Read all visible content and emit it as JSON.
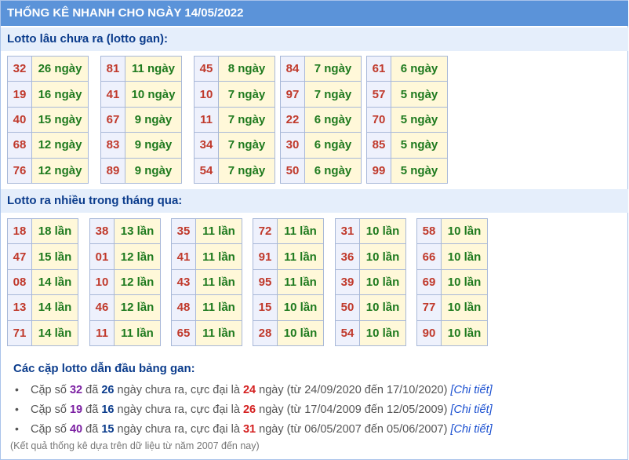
{
  "header": {
    "title": "THỐNG KÊ NHANH CHO NGÀY 14/05/2022"
  },
  "section_gan": {
    "title": "Lotto lâu chưa ra (lotto gan):",
    "groups": [
      [
        {
          "num": "32",
          "val": "26 ngày"
        },
        {
          "num": "19",
          "val": "16 ngày"
        },
        {
          "num": "40",
          "val": "15 ngày"
        },
        {
          "num": "68",
          "val": "12 ngày"
        },
        {
          "num": "76",
          "val": "12 ngày"
        }
      ],
      [
        {
          "num": "81",
          "val": "11 ngày"
        },
        {
          "num": "41",
          "val": "10 ngày"
        },
        {
          "num": "67",
          "val": "9 ngày"
        },
        {
          "num": "83",
          "val": "9 ngày"
        },
        {
          "num": "89",
          "val": "9 ngày"
        }
      ],
      [
        {
          "num": "45",
          "val": "8 ngày"
        },
        {
          "num": "10",
          "val": "7 ngày"
        },
        {
          "num": "11",
          "val": "7 ngày"
        },
        {
          "num": "34",
          "val": "7 ngày"
        },
        {
          "num": "54",
          "val": "7 ngày"
        }
      ],
      [
        {
          "num": "84",
          "val": "7 ngày"
        },
        {
          "num": "97",
          "val": "7 ngày"
        },
        {
          "num": "22",
          "val": "6 ngày"
        },
        {
          "num": "30",
          "val": "6 ngày"
        },
        {
          "num": "50",
          "val": "6 ngày"
        }
      ],
      [
        {
          "num": "61",
          "val": "6 ngày"
        },
        {
          "num": "57",
          "val": "5 ngày"
        },
        {
          "num": "70",
          "val": "5 ngày"
        },
        {
          "num": "85",
          "val": "5 ngày"
        },
        {
          "num": "99",
          "val": "5 ngày"
        }
      ]
    ]
  },
  "section_frequent": {
    "title": "Lotto ra nhiều trong tháng qua:",
    "groups": [
      [
        {
          "num": "18",
          "val": "18 lần"
        },
        {
          "num": "47",
          "val": "15 lần"
        },
        {
          "num": "08",
          "val": "14 lần"
        },
        {
          "num": "13",
          "val": "14 lần"
        },
        {
          "num": "71",
          "val": "14 lần"
        }
      ],
      [
        {
          "num": "38",
          "val": "13 lần"
        },
        {
          "num": "01",
          "val": "12 lần"
        },
        {
          "num": "10",
          "val": "12 lần"
        },
        {
          "num": "46",
          "val": "12 lần"
        },
        {
          "num": "11",
          "val": "11 lần"
        }
      ],
      [
        {
          "num": "35",
          "val": "11 lần"
        },
        {
          "num": "41",
          "val": "11 lần"
        },
        {
          "num": "43",
          "val": "11 lần"
        },
        {
          "num": "48",
          "val": "11 lần"
        },
        {
          "num": "65",
          "val": "11 lần"
        }
      ],
      [
        {
          "num": "72",
          "val": "11 lần"
        },
        {
          "num": "91",
          "val": "11 lần"
        },
        {
          "num": "95",
          "val": "11 lần"
        },
        {
          "num": "15",
          "val": "10 lần"
        },
        {
          "num": "28",
          "val": "10 lần"
        }
      ],
      [
        {
          "num": "31",
          "val": "10 lần"
        },
        {
          "num": "36",
          "val": "10 lần"
        },
        {
          "num": "39",
          "val": "10 lần"
        },
        {
          "num": "50",
          "val": "10 lần"
        },
        {
          "num": "54",
          "val": "10 lần"
        }
      ],
      [
        {
          "num": "58",
          "val": "10 lần"
        },
        {
          "num": "66",
          "val": "10 lần"
        },
        {
          "num": "69",
          "val": "10 lần"
        },
        {
          "num": "77",
          "val": "10 lần"
        },
        {
          "num": "90",
          "val": "10 lần"
        }
      ]
    ]
  },
  "pairs": {
    "title": "Các cặp lotto dẫn đầu bảng gan:",
    "items": [
      {
        "prefix": "Cặp số",
        "num": "32",
        "w1": "đã",
        "days": "26",
        "w2": "ngày chưa ra, cực đại là",
        "max": "24",
        "w3": "ngày (từ 24/09/2020 đến 17/10/2020)",
        "link": "[Chi tiết]"
      },
      {
        "prefix": "Cặp số",
        "num": "19",
        "w1": "đã",
        "days": "16",
        "w2": "ngày chưa ra, cực đại là",
        "max": "26",
        "w3": "ngày (từ 17/04/2009 đến 12/05/2009)",
        "link": "[Chi tiết]"
      },
      {
        "prefix": "Cặp số",
        "num": "40",
        "w1": "đã",
        "days": "15",
        "w2": "ngày chưa ra, cực đại là",
        "max": "31",
        "w3": "ngày (từ 06/05/2007 đến 05/06/2007)",
        "link": "[Chi tiết]"
      }
    ],
    "footnote": "(Kết quả thống kê dựa trên dữ liệu từ năm 2007 đến nay)"
  }
}
